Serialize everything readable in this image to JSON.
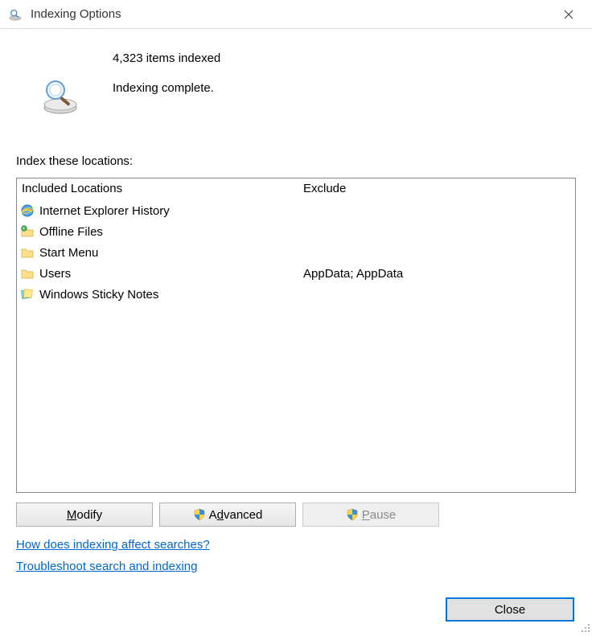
{
  "titlebar": {
    "title": "Indexing Options"
  },
  "status": {
    "items_indexed": "4,323 items indexed",
    "indexing_status": "Indexing complete."
  },
  "section_label": "Index these locations:",
  "columns": {
    "included_header": "Included Locations",
    "exclude_header": "Exclude"
  },
  "rows": [
    {
      "icon": "ie-icon",
      "label": "Internet Explorer History",
      "exclude": ""
    },
    {
      "icon": "offline-files-icon",
      "label": "Offline Files",
      "exclude": ""
    },
    {
      "icon": "folder-icon",
      "label": "Start Menu",
      "exclude": ""
    },
    {
      "icon": "folder-icon",
      "label": "Users",
      "exclude": "AppData; AppData"
    },
    {
      "icon": "sticky-notes-icon",
      "label": "Windows Sticky Notes",
      "exclude": ""
    }
  ],
  "buttons": {
    "modify": "Modify",
    "advanced": "Advanced",
    "pause": "Pause",
    "close": "Close"
  },
  "links": {
    "how_does": "How does indexing affect searches?",
    "troubleshoot": "Troubleshoot search and indexing"
  }
}
